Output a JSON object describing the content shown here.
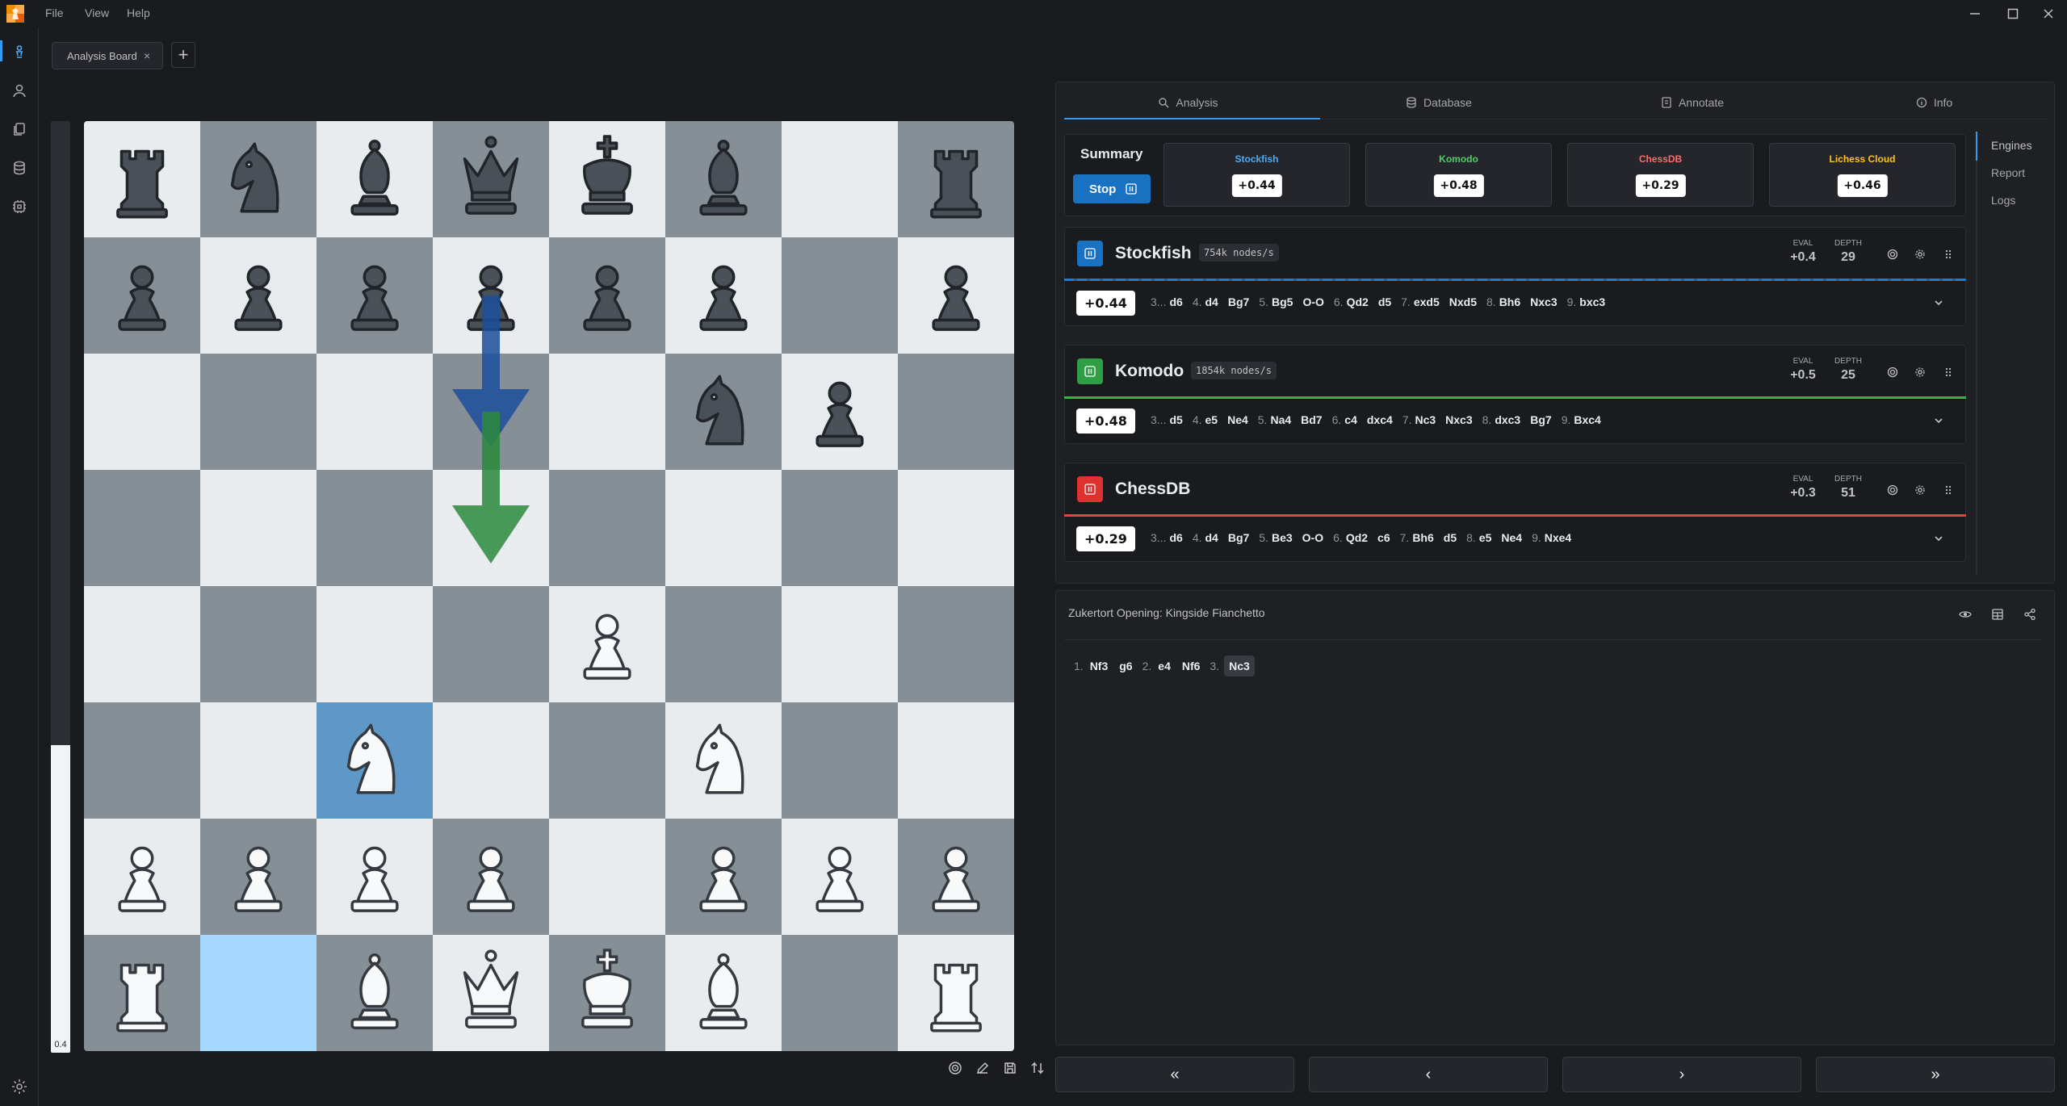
{
  "menu": {
    "file": "File",
    "view": "View",
    "help": "Help"
  },
  "tabs": {
    "active_tab": "Analysis Board",
    "close": "×",
    "add": "+"
  },
  "eval_bar": {
    "label": "0.4",
    "white_fraction": 0.33
  },
  "board": {
    "light_color": "#e9ecef",
    "dark_color": "#868e96",
    "highlight_from": "#a5d8ff",
    "highlight_to": "#5f97c7",
    "highlight_squares": {
      "from": "b1",
      "to": "c3"
    },
    "pieces": [
      {
        "sq": "a8",
        "p": "bR"
      },
      {
        "sq": "b8",
        "p": "bN"
      },
      {
        "sq": "c8",
        "p": "bB"
      },
      {
        "sq": "d8",
        "p": "bQ"
      },
      {
        "sq": "e8",
        "p": "bK"
      },
      {
        "sq": "f8",
        "p": "bB"
      },
      {
        "sq": "h8",
        "p": "bR"
      },
      {
        "sq": "a7",
        "p": "bP"
      },
      {
        "sq": "b7",
        "p": "bP"
      },
      {
        "sq": "c7",
        "p": "bP"
      },
      {
        "sq": "d7",
        "p": "bP"
      },
      {
        "sq": "e7",
        "p": "bP"
      },
      {
        "sq": "f7",
        "p": "bP"
      },
      {
        "sq": "h7",
        "p": "bP"
      },
      {
        "sq": "f6",
        "p": "bN"
      },
      {
        "sq": "g6",
        "p": "bP"
      },
      {
        "sq": "e4",
        "p": "wP"
      },
      {
        "sq": "c3",
        "p": "wN"
      },
      {
        "sq": "f3",
        "p": "wN"
      },
      {
        "sq": "a2",
        "p": "wP"
      },
      {
        "sq": "b2",
        "p": "wP"
      },
      {
        "sq": "c2",
        "p": "wP"
      },
      {
        "sq": "d2",
        "p": "wP"
      },
      {
        "sq": "f2",
        "p": "wP"
      },
      {
        "sq": "g2",
        "p": "wP"
      },
      {
        "sq": "h2",
        "p": "wP"
      },
      {
        "sq": "a1",
        "p": "wR"
      },
      {
        "sq": "c1",
        "p": "wB"
      },
      {
        "sq": "d1",
        "p": "wQ"
      },
      {
        "sq": "e1",
        "p": "wK"
      },
      {
        "sq": "f1",
        "p": "wB"
      },
      {
        "sq": "h1",
        "p": "wR"
      }
    ],
    "arrows": [
      {
        "from": "d7",
        "to": "d6",
        "color": "#1c4f9c"
      },
      {
        "from": "d6",
        "to": "d5",
        "color": "#2b8a3e"
      }
    ]
  },
  "right_tabs": [
    {
      "label": "Analysis",
      "icon": "search-icon"
    },
    {
      "label": "Database",
      "icon": "database-icon"
    },
    {
      "label": "Annotate",
      "icon": "annotate-icon"
    },
    {
      "label": "Info",
      "icon": "info-icon"
    }
  ],
  "summary": {
    "title": "Summary",
    "stop_label": "Stop",
    "cards": [
      {
        "name": "Stockfish",
        "score": "+0.44",
        "color": "#4dabf7"
      },
      {
        "name": "Komodo",
        "score": "+0.48",
        "color": "#51cf66"
      },
      {
        "name": "ChessDB",
        "score": "+0.29",
        "color": "#ff6b6b"
      },
      {
        "name": "Lichess Cloud",
        "score": "+0.46",
        "color": "#fcc419"
      }
    ]
  },
  "side_nav": {
    "engines": "Engines",
    "report": "Report",
    "logs": "Logs"
  },
  "engines": [
    {
      "name": "Stockfish",
      "nps": "754k nodes/s",
      "icon_color": "#1971c2",
      "line_color": "#1c7ed6",
      "eval_label": "EVAL",
      "eval": "+0.4",
      "depth_label": "DEPTH",
      "depth": "29",
      "pv_score": "+0.44",
      "pv": [
        [
          "3...",
          "d6"
        ],
        [
          "4.",
          "d4"
        ],
        [
          "",
          "Bg7"
        ],
        [
          "5.",
          "Bg5"
        ],
        [
          "",
          "O-O"
        ],
        [
          "6.",
          "Qd2"
        ],
        [
          "",
          "d5"
        ],
        [
          "7.",
          "exd5"
        ],
        [
          "",
          "Nxd5"
        ],
        [
          "8.",
          "Bh6"
        ],
        [
          "",
          "Nxc3"
        ],
        [
          "9.",
          "bxc3"
        ]
      ]
    },
    {
      "name": "Komodo",
      "nps": "1854k nodes/s",
      "icon_color": "#2f9e44",
      "line_color": "#37b24d",
      "eval_label": "EVAL",
      "eval": "+0.5",
      "depth_label": "DEPTH",
      "depth": "25",
      "pv_score": "+0.48",
      "pv": [
        [
          "3...",
          "d5"
        ],
        [
          "4.",
          "e5"
        ],
        [
          "",
          "Ne4"
        ],
        [
          "5.",
          "Na4"
        ],
        [
          "",
          "Bd7"
        ],
        [
          "6.",
          "c4"
        ],
        [
          "",
          "dxc4"
        ],
        [
          "7.",
          "Nc3"
        ],
        [
          "",
          "Nxc3"
        ],
        [
          "8.",
          "dxc3"
        ],
        [
          "",
          "Bg7"
        ],
        [
          "9.",
          "Bxc4"
        ]
      ]
    },
    {
      "name": "ChessDB",
      "nps": "",
      "icon_color": "#e03131",
      "line_color": "#f03e3e",
      "eval_label": "EVAL",
      "eval": "+0.3",
      "depth_label": "DEPTH",
      "depth": "51",
      "pv_score": "+0.29",
      "pv": [
        [
          "3...",
          "d6"
        ],
        [
          "4.",
          "d4"
        ],
        [
          "",
          "Bg7"
        ],
        [
          "5.",
          "Be3"
        ],
        [
          "",
          "O-O"
        ],
        [
          "6.",
          "Qd2"
        ],
        [
          "",
          "c6"
        ],
        [
          "7.",
          "Bh6"
        ],
        [
          "",
          "d5"
        ],
        [
          "8.",
          "e5"
        ],
        [
          "",
          "Ne4"
        ],
        [
          "9.",
          "Nxe4"
        ]
      ]
    }
  ],
  "notation": {
    "opening": "Zukertort Opening: Kingside Fianchetto",
    "moves": [
      [
        "1.",
        "Nf3"
      ],
      [
        "",
        "g6"
      ],
      [
        "2.",
        "e4"
      ],
      [
        "",
        "Nf6"
      ],
      [
        "3.",
        "Nc3"
      ]
    ],
    "current_index": 4
  },
  "nav": {
    "first": "«",
    "prev": "‹",
    "next": "›",
    "last": "»"
  }
}
